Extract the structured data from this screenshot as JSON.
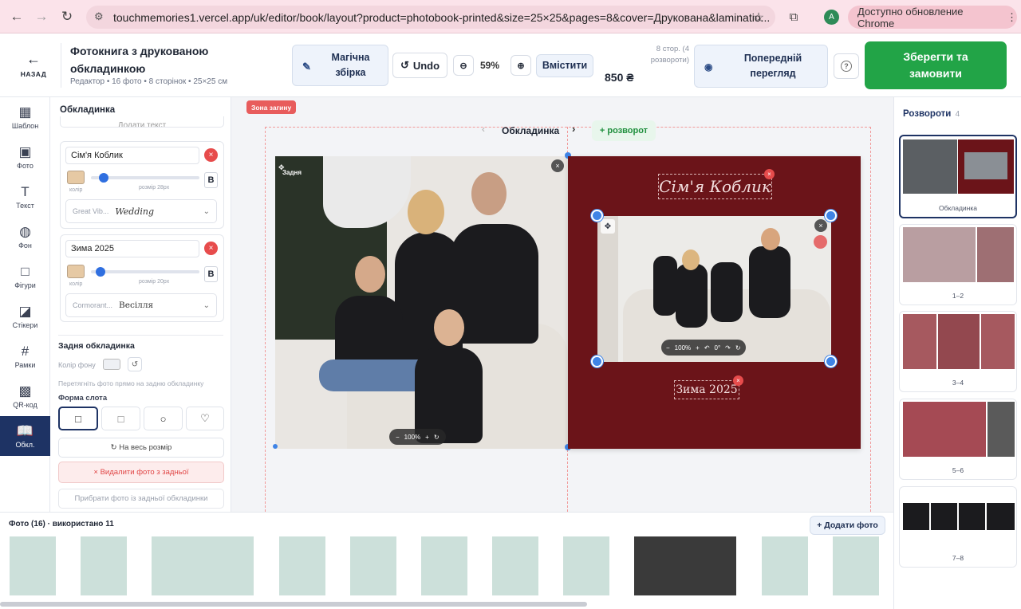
{
  "browser": {
    "url": "touchmemories1.vercel.app/uk/editor/book/layout?product=photobook-printed&size=25×25&pages=8&cover=Друкована&laminatio...",
    "profile_initial": "A",
    "update_label": "Доступно обновление Chrome"
  },
  "header": {
    "back_label": "НАЗАД",
    "title": "Фотокнига з друкованою обкладинкою",
    "subtitle": "Редактор • 16 фото • 8 сторінок • 25×25 см",
    "magic_label": "Магічна збірка",
    "undo_label": "Undo",
    "zoom_value": "59%",
    "fit_label": "Вмістити",
    "pages_info": "8 стор. (4 розвороти)",
    "price": "850 ₴",
    "preview_label": "Попередній перегляд",
    "help_icon": "?",
    "save_label": "Зберегти та замовити"
  },
  "rail": {
    "items": [
      {
        "label": "Шаблон",
        "icon": "▦"
      },
      {
        "label": "Фото",
        "icon": "▣"
      },
      {
        "label": "Текст",
        "icon": "T"
      },
      {
        "label": "Фон",
        "icon": "◍"
      },
      {
        "label": "Фігури",
        "icon": "□"
      },
      {
        "label": "Стікери",
        "icon": "◪"
      },
      {
        "label": "Рамки",
        "icon": "#"
      },
      {
        "label": "QR-код",
        "icon": "▩"
      },
      {
        "label": "Обкл.",
        "icon": "📖"
      }
    ]
  },
  "panel": {
    "title": "Обкладинка",
    "add_text_label": "Додати текст",
    "text_items": [
      {
        "value": "Сім'я Коблик",
        "color_label": "колір",
        "size_label": "розмір 28px",
        "bold_label": "B",
        "font_name": "Great Vib...",
        "font_preview": "Wedding"
      },
      {
        "value": "Зима 2025",
        "color_label": "колір",
        "size_label": "розмір 20px",
        "bold_label": "B",
        "font_name": "Cormorant...",
        "font_preview": "Весілля"
      }
    ],
    "back_cover_title": "Задня обкладинка",
    "bg_color_label": "Колір фону",
    "drag_hint": "Перетягніть фото прямо на задню обкладинку",
    "slot_shape_title": "Форма слота",
    "slot_shapes": [
      "□",
      "□",
      "○",
      "♡"
    ],
    "fullsize_label": "↻ На весь розмір",
    "delete_photo_label": "× Видалити фото з задньої",
    "remove_photo_label": "Прибрати фото із задньої обкладинки"
  },
  "canvas": {
    "fold_zone_label": "Зона загину",
    "spread_title": "Обкладинка",
    "add_spread_label": "+ розворот",
    "back_tag": "Задня",
    "left_zoom": "100%",
    "cover_title_text": "Сім'я Коблик",
    "cover_subtitle_text": "Зима 2025",
    "right_zoom": "100%",
    "rotation": "0°"
  },
  "photos": {
    "header": "Фото (16) · використано 11",
    "add_label": "+ Додати фото"
  },
  "spreads": {
    "title": "Розвороти",
    "count": "4",
    "items": [
      {
        "label": "Обкладинка"
      },
      {
        "label": "1–2"
      },
      {
        "label": "3–4"
      },
      {
        "label": "5–6"
      },
      {
        "label": "7–8"
      }
    ]
  },
  "colors": {
    "accent": "#1e3364",
    "save_green": "#22a447",
    "cover_burgundy": "#6b1419",
    "danger": "#e74c4c",
    "handle_blue": "#3f84e6"
  }
}
